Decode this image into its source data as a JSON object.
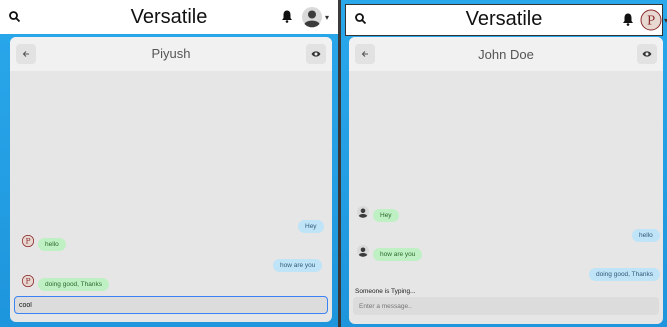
{
  "left": {
    "app_title": "Versatile",
    "chat_title": "Piyush",
    "messages": [
      {
        "text": "Hey",
        "dir": "out"
      },
      {
        "text": "hello",
        "dir": "in"
      },
      {
        "text": "how are you",
        "dir": "out"
      },
      {
        "text": "doing good, Thanks",
        "dir": "in"
      }
    ],
    "input_value": "cool"
  },
  "right": {
    "app_title": "Versatile",
    "chat_title": "John Doe",
    "messages": [
      {
        "text": "Hey",
        "dir": "in"
      },
      {
        "text": "hello",
        "dir": "out"
      },
      {
        "text": "how are you",
        "dir": "in"
      },
      {
        "text": "doing good, Thanks",
        "dir": "out"
      }
    ],
    "typing_text": "Someone is Typing...",
    "input_placeholder": "Enter a message.."
  },
  "icons": [
    "search-icon",
    "bell-icon",
    "user-avatar",
    "chevron-down-icon",
    "back-arrow-icon",
    "eye-icon"
  ],
  "colors": {
    "background": "#1a9be0",
    "incoming_bubble": "#bff0c4",
    "outgoing_bubble": "#bfe4f7",
    "input_focus": "#3b82f6"
  }
}
